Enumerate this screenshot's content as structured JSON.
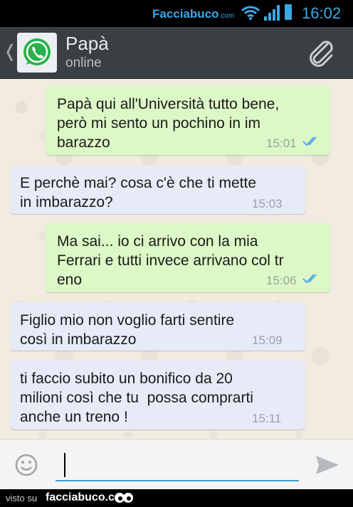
{
  "status_bar": {
    "watermark": "Facciabuco",
    "watermark_suffix": ".com",
    "time": "16:02"
  },
  "header": {
    "back_glyph": "❬",
    "contact_name": "Papà",
    "contact_status": "online",
    "avatar_icon": "whatsapp-logo",
    "attach_icon": "paperclip-icon"
  },
  "messages": [
    {
      "direction": "out",
      "text": "Papà qui all'Università tutto bene,\nperò mi sento un pochino in im\nbarazzo",
      "time": "15:01",
      "read": true
    },
    {
      "direction": "in",
      "text": "E perchè mai? cosa c'è che ti mette\nin imbarazzo?",
      "time": "15:03"
    },
    {
      "direction": "out",
      "text": "Ma sai... io ci arrivo con la mia\nFerrari e tutti invece arrivano col tr\neno",
      "time": "15:06",
      "read": true
    },
    {
      "direction": "in",
      "text": "Figlio mio non voglio farti sentire\ncosì in imbarazzo",
      "time": "15:09"
    },
    {
      "direction": "in",
      "text": "ti faccio subito un bonifico da 20\nmilioni così che tu  possa comprarti\nanche un treno !",
      "time": "15:11"
    }
  ],
  "input": {
    "value": "",
    "emoji_icon": "smiley-icon",
    "send_icon": "send-icon"
  },
  "footer": {
    "prefix": "visto su",
    "site": "facciabuco.com"
  },
  "colors": {
    "outgoing_bubble": "#dcf8c6",
    "incoming_bubble": "#e6ebf7",
    "accent": "#3aa8e6",
    "read_ticks": "#4fa8e8"
  }
}
